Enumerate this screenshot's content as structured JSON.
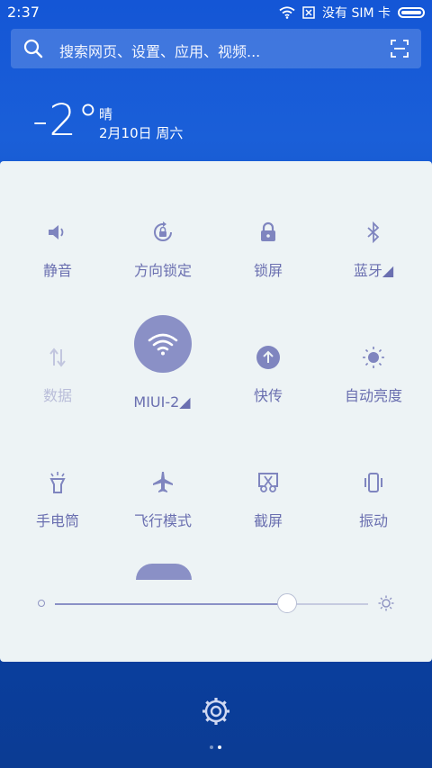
{
  "status_bar": {
    "time": "2:37",
    "carrier": "没有 SIM 卡"
  },
  "search": {
    "placeholder": "搜索网页、设置、应用、视频..."
  },
  "weather": {
    "temperature": "-2°",
    "condition": "晴",
    "date": "2月10日 周六"
  },
  "tiles": [
    {
      "label": "静音",
      "icon": "speaker-icon",
      "enabled": true
    },
    {
      "label": "方向锁定",
      "icon": "rotation-lock-icon",
      "enabled": true
    },
    {
      "label": "锁屏",
      "icon": "lock-icon",
      "enabled": true
    },
    {
      "label": "蓝牙◢",
      "icon": "bluetooth-icon",
      "enabled": true
    },
    {
      "label": "数据",
      "icon": "data-arrows-icon",
      "enabled": false
    },
    {
      "label": "MIUI-2◢",
      "icon": "wifi-icon",
      "enabled": true
    },
    {
      "label": "快传",
      "icon": "upload-icon",
      "enabled": true
    },
    {
      "label": "自动亮度",
      "icon": "auto-brightness-icon",
      "enabled": true
    },
    {
      "label": "手电筒",
      "icon": "flashlight-icon",
      "enabled": true
    },
    {
      "label": "飞行模式",
      "icon": "airplane-icon",
      "enabled": true
    },
    {
      "label": "截屏",
      "icon": "screenshot-icon",
      "enabled": true
    },
    {
      "label": "振动",
      "icon": "vibrate-icon",
      "enabled": true
    }
  ],
  "brightness": {
    "level": 0.74
  },
  "colors": {
    "accent": "#8a90c6",
    "panel": "#edf3f5",
    "background": "#1456d6"
  }
}
